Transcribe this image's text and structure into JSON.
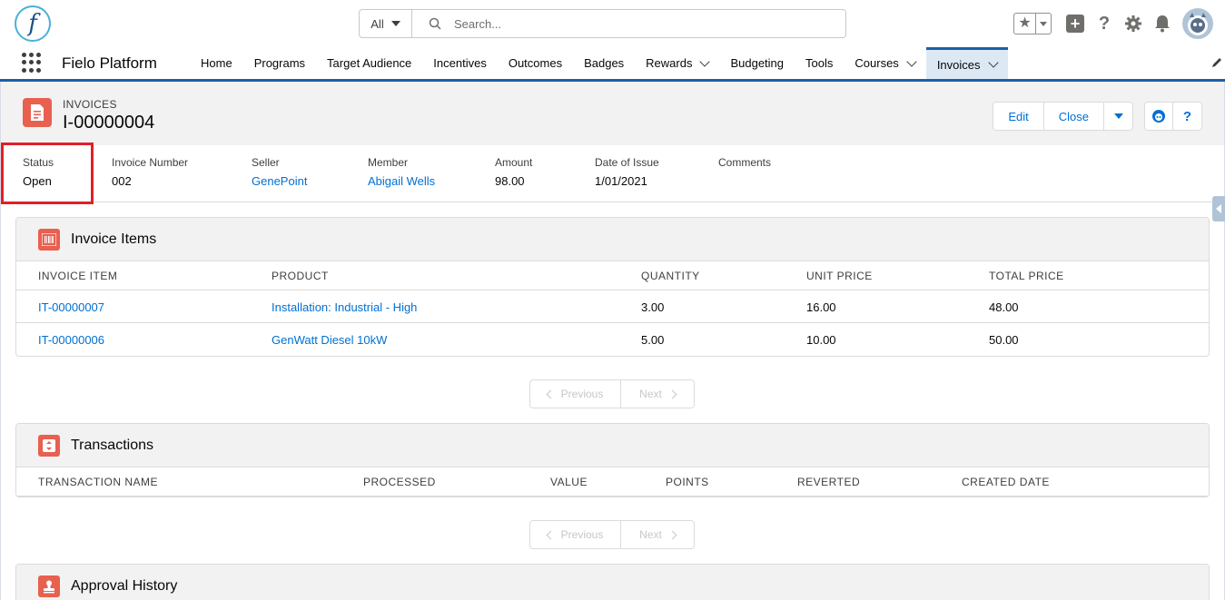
{
  "app": {
    "name": "Fielo Platform",
    "logo_letter": "f"
  },
  "search": {
    "scope": "All",
    "placeholder": "Search..."
  },
  "nav": {
    "items": [
      {
        "label": "Home",
        "dropdown": false
      },
      {
        "label": "Programs",
        "dropdown": false
      },
      {
        "label": "Target Audience",
        "dropdown": false
      },
      {
        "label": "Incentives",
        "dropdown": false
      },
      {
        "label": "Outcomes",
        "dropdown": false
      },
      {
        "label": "Badges",
        "dropdown": false
      },
      {
        "label": "Rewards",
        "dropdown": true
      },
      {
        "label": "Budgeting",
        "dropdown": false
      },
      {
        "label": "Tools",
        "dropdown": false
      },
      {
        "label": "Courses",
        "dropdown": true
      },
      {
        "label": "Invoices",
        "dropdown": true,
        "active": true
      }
    ]
  },
  "record": {
    "type_label": "INVOICES",
    "title": "I-00000004",
    "actions": {
      "edit": "Edit",
      "close": "Close"
    },
    "help": "?"
  },
  "highlights": {
    "status": {
      "label": "Status",
      "value": "Open"
    },
    "invoice_number": {
      "label": "Invoice Number",
      "value": "002"
    },
    "seller": {
      "label": "Seller",
      "value": "GenePoint"
    },
    "member": {
      "label": "Member",
      "value": "Abigail Wells"
    },
    "amount": {
      "label": "Amount",
      "value": "98.00"
    },
    "date_of_issue": {
      "label": "Date of Issue",
      "value": "1/01/2021"
    },
    "comments": {
      "label": "Comments",
      "value": ""
    }
  },
  "invoice_items": {
    "title": "Invoice Items",
    "columns": [
      "INVOICE ITEM",
      "PRODUCT",
      "QUANTITY",
      "UNIT PRICE",
      "TOTAL PRICE"
    ],
    "rows": [
      {
        "item": "IT-00000007",
        "product": "Installation: Industrial - High",
        "quantity": "3.00",
        "unit_price": "16.00",
        "total_price": "48.00"
      },
      {
        "item": "IT-00000006",
        "product": "GenWatt Diesel 10kW",
        "quantity": "5.00",
        "unit_price": "10.00",
        "total_price": "50.00"
      }
    ],
    "pager": {
      "previous": "Previous",
      "next": "Next"
    }
  },
  "transactions": {
    "title": "Transactions",
    "columns": [
      "TRANSACTION NAME",
      "PROCESSED",
      "VALUE",
      "POINTS",
      "REVERTED",
      "CREATED DATE"
    ],
    "pager": {
      "previous": "Previous",
      "next": "Next"
    }
  },
  "approval_history": {
    "title": "Approval History"
  },
  "colors": {
    "brand": "#1b5fa7",
    "link": "#0070d2",
    "record_icon": "#e8604f",
    "highlight_box": "#e0202a"
  }
}
